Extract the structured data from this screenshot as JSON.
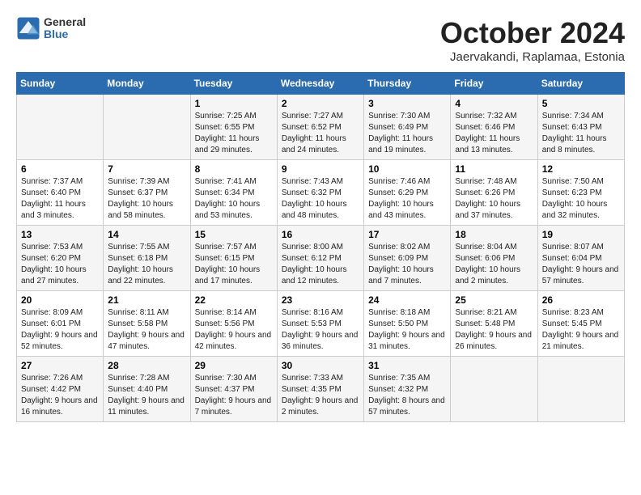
{
  "logo": {
    "general": "General",
    "blue": "Blue"
  },
  "header": {
    "month": "October 2024",
    "location": "Jaervakandi, Raplamaa, Estonia"
  },
  "weekdays": [
    "Sunday",
    "Monday",
    "Tuesday",
    "Wednesday",
    "Thursday",
    "Friday",
    "Saturday"
  ],
  "weeks": [
    [
      {
        "day": "",
        "sunrise": "",
        "sunset": "",
        "daylight": ""
      },
      {
        "day": "",
        "sunrise": "",
        "sunset": "",
        "daylight": ""
      },
      {
        "day": "1",
        "sunrise": "Sunrise: 7:25 AM",
        "sunset": "Sunset: 6:55 PM",
        "daylight": "Daylight: 11 hours and 29 minutes."
      },
      {
        "day": "2",
        "sunrise": "Sunrise: 7:27 AM",
        "sunset": "Sunset: 6:52 PM",
        "daylight": "Daylight: 11 hours and 24 minutes."
      },
      {
        "day": "3",
        "sunrise": "Sunrise: 7:30 AM",
        "sunset": "Sunset: 6:49 PM",
        "daylight": "Daylight: 11 hours and 19 minutes."
      },
      {
        "day": "4",
        "sunrise": "Sunrise: 7:32 AM",
        "sunset": "Sunset: 6:46 PM",
        "daylight": "Daylight: 11 hours and 13 minutes."
      },
      {
        "day": "5",
        "sunrise": "Sunrise: 7:34 AM",
        "sunset": "Sunset: 6:43 PM",
        "daylight": "Daylight: 11 hours and 8 minutes."
      }
    ],
    [
      {
        "day": "6",
        "sunrise": "Sunrise: 7:37 AM",
        "sunset": "Sunset: 6:40 PM",
        "daylight": "Daylight: 11 hours and 3 minutes."
      },
      {
        "day": "7",
        "sunrise": "Sunrise: 7:39 AM",
        "sunset": "Sunset: 6:37 PM",
        "daylight": "Daylight: 10 hours and 58 minutes."
      },
      {
        "day": "8",
        "sunrise": "Sunrise: 7:41 AM",
        "sunset": "Sunset: 6:34 PM",
        "daylight": "Daylight: 10 hours and 53 minutes."
      },
      {
        "day": "9",
        "sunrise": "Sunrise: 7:43 AM",
        "sunset": "Sunset: 6:32 PM",
        "daylight": "Daylight: 10 hours and 48 minutes."
      },
      {
        "day": "10",
        "sunrise": "Sunrise: 7:46 AM",
        "sunset": "Sunset: 6:29 PM",
        "daylight": "Daylight: 10 hours and 43 minutes."
      },
      {
        "day": "11",
        "sunrise": "Sunrise: 7:48 AM",
        "sunset": "Sunset: 6:26 PM",
        "daylight": "Daylight: 10 hours and 37 minutes."
      },
      {
        "day": "12",
        "sunrise": "Sunrise: 7:50 AM",
        "sunset": "Sunset: 6:23 PM",
        "daylight": "Daylight: 10 hours and 32 minutes."
      }
    ],
    [
      {
        "day": "13",
        "sunrise": "Sunrise: 7:53 AM",
        "sunset": "Sunset: 6:20 PM",
        "daylight": "Daylight: 10 hours and 27 minutes."
      },
      {
        "day": "14",
        "sunrise": "Sunrise: 7:55 AM",
        "sunset": "Sunset: 6:18 PM",
        "daylight": "Daylight: 10 hours and 22 minutes."
      },
      {
        "day": "15",
        "sunrise": "Sunrise: 7:57 AM",
        "sunset": "Sunset: 6:15 PM",
        "daylight": "Daylight: 10 hours and 17 minutes."
      },
      {
        "day": "16",
        "sunrise": "Sunrise: 8:00 AM",
        "sunset": "Sunset: 6:12 PM",
        "daylight": "Daylight: 10 hours and 12 minutes."
      },
      {
        "day": "17",
        "sunrise": "Sunrise: 8:02 AM",
        "sunset": "Sunset: 6:09 PM",
        "daylight": "Daylight: 10 hours and 7 minutes."
      },
      {
        "day": "18",
        "sunrise": "Sunrise: 8:04 AM",
        "sunset": "Sunset: 6:06 PM",
        "daylight": "Daylight: 10 hours and 2 minutes."
      },
      {
        "day": "19",
        "sunrise": "Sunrise: 8:07 AM",
        "sunset": "Sunset: 6:04 PM",
        "daylight": "Daylight: 9 hours and 57 minutes."
      }
    ],
    [
      {
        "day": "20",
        "sunrise": "Sunrise: 8:09 AM",
        "sunset": "Sunset: 6:01 PM",
        "daylight": "Daylight: 9 hours and 52 minutes."
      },
      {
        "day": "21",
        "sunrise": "Sunrise: 8:11 AM",
        "sunset": "Sunset: 5:58 PM",
        "daylight": "Daylight: 9 hours and 47 minutes."
      },
      {
        "day": "22",
        "sunrise": "Sunrise: 8:14 AM",
        "sunset": "Sunset: 5:56 PM",
        "daylight": "Daylight: 9 hours and 42 minutes."
      },
      {
        "day": "23",
        "sunrise": "Sunrise: 8:16 AM",
        "sunset": "Sunset: 5:53 PM",
        "daylight": "Daylight: 9 hours and 36 minutes."
      },
      {
        "day": "24",
        "sunrise": "Sunrise: 8:18 AM",
        "sunset": "Sunset: 5:50 PM",
        "daylight": "Daylight: 9 hours and 31 minutes."
      },
      {
        "day": "25",
        "sunrise": "Sunrise: 8:21 AM",
        "sunset": "Sunset: 5:48 PM",
        "daylight": "Daylight: 9 hours and 26 minutes."
      },
      {
        "day": "26",
        "sunrise": "Sunrise: 8:23 AM",
        "sunset": "Sunset: 5:45 PM",
        "daylight": "Daylight: 9 hours and 21 minutes."
      }
    ],
    [
      {
        "day": "27",
        "sunrise": "Sunrise: 7:26 AM",
        "sunset": "Sunset: 4:42 PM",
        "daylight": "Daylight: 9 hours and 16 minutes."
      },
      {
        "day": "28",
        "sunrise": "Sunrise: 7:28 AM",
        "sunset": "Sunset: 4:40 PM",
        "daylight": "Daylight: 9 hours and 11 minutes."
      },
      {
        "day": "29",
        "sunrise": "Sunrise: 7:30 AM",
        "sunset": "Sunset: 4:37 PM",
        "daylight": "Daylight: 9 hours and 7 minutes."
      },
      {
        "day": "30",
        "sunrise": "Sunrise: 7:33 AM",
        "sunset": "Sunset: 4:35 PM",
        "daylight": "Daylight: 9 hours and 2 minutes."
      },
      {
        "day": "31",
        "sunrise": "Sunrise: 7:35 AM",
        "sunset": "Sunset: 4:32 PM",
        "daylight": "Daylight: 8 hours and 57 minutes."
      },
      {
        "day": "",
        "sunrise": "",
        "sunset": "",
        "daylight": ""
      },
      {
        "day": "",
        "sunrise": "",
        "sunset": "",
        "daylight": ""
      }
    ]
  ]
}
